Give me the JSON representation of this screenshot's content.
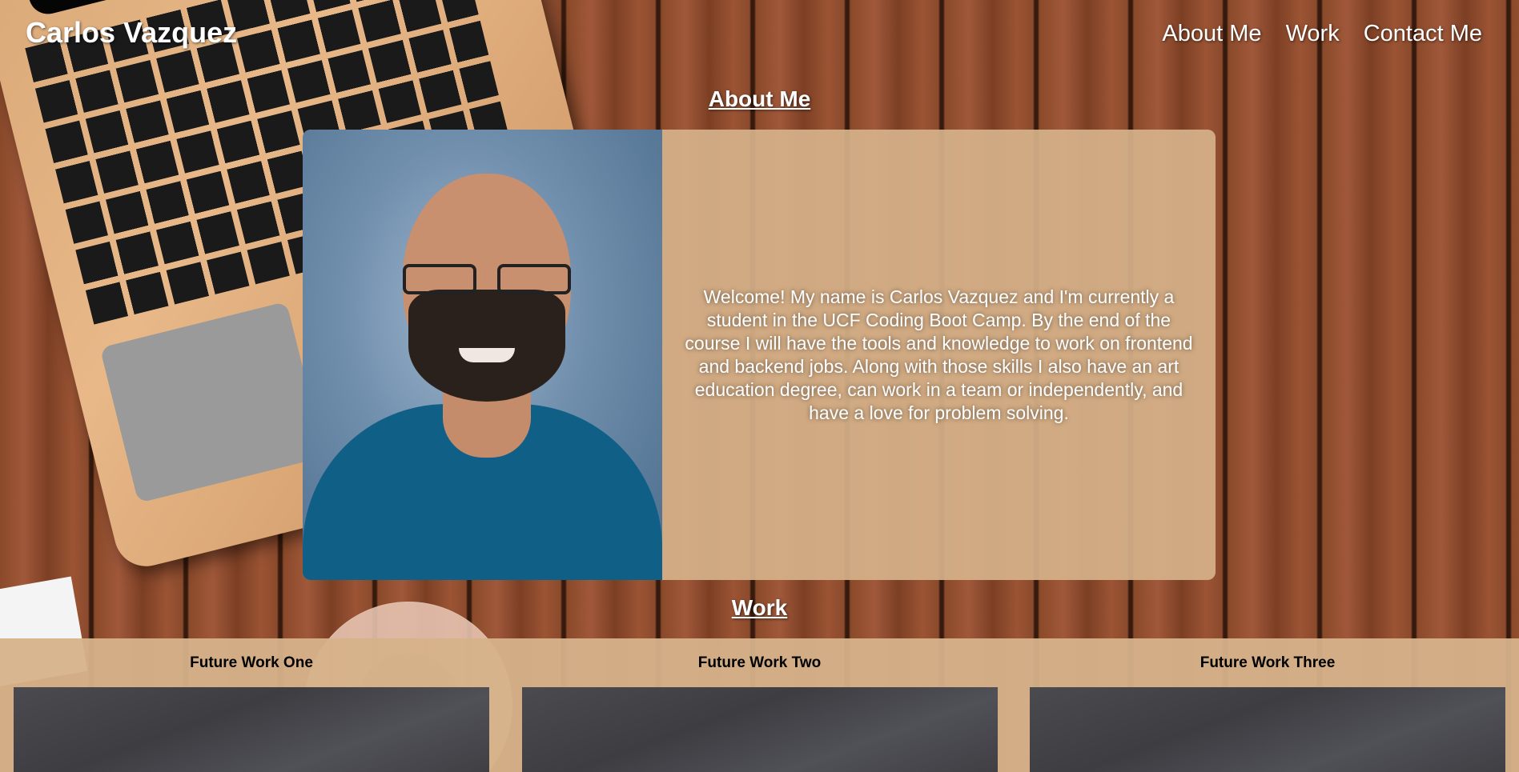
{
  "header": {
    "title": "Carlos Vazquez",
    "nav": [
      "About Me",
      "Work",
      "Contact Me"
    ]
  },
  "about": {
    "heading": "About Me",
    "photo_alt": "Portrait of Carlos Vazquez",
    "bio": "Welcome! My name is Carlos Vazquez and I'm currently a student in the UCF Coding Boot Camp. By the end of the course I will have the tools and knowledge to work on frontend and backend jobs. Along with those skills I also have an art education degree, can work in a team or independently, and have a love for problem solving."
  },
  "work": {
    "heading": "Work",
    "items": [
      {
        "title": "Future Work One"
      },
      {
        "title": "Future Work Two"
      },
      {
        "title": "Future Work Three"
      }
    ]
  },
  "colors": {
    "card_tan": "#d6b28a",
    "heading_white": "#ffffff",
    "shirt_blue": "#0f5f86"
  }
}
